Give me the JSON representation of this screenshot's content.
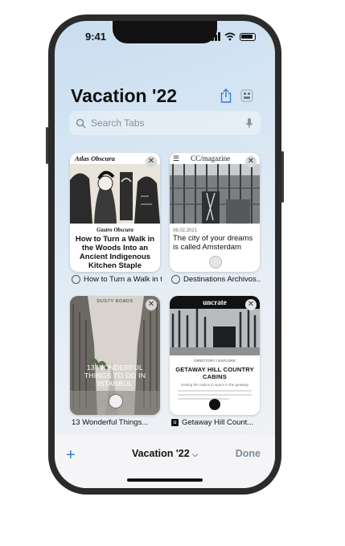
{
  "status": {
    "time": "9:41"
  },
  "header": {
    "title": "Vacation '22"
  },
  "search": {
    "placeholder": "Search Tabs"
  },
  "tabs": [
    {
      "site": "Atlas Obscura",
      "category": "Gastro Obscura",
      "headline": "How to Turn a Walk in the Woods Into an Ancient Indigenous Kitchen Staple",
      "label": "How to Turn a Walk in t..."
    },
    {
      "site": "CC/magazine",
      "date": "06.02.2021",
      "headline": "The city of your dreams is called Amsterdam",
      "label": "Destinations Archivos..."
    },
    {
      "site": "DUSTY ROADS",
      "headline": "13 WONDERFUL THINGS TO DO IN ISTANBUL",
      "label": "13 Wonderful Things..."
    },
    {
      "site": "uncrate",
      "kicker": "DIRECTORY / EXPLORE",
      "headline": "GETAWAY HILL COUNTRY CABINS",
      "sub": "Getting the cabins in space in the getaway",
      "label": "Getaway Hill Count..."
    }
  ],
  "toolbar": {
    "group": "Vacation '22",
    "done": "Done"
  }
}
